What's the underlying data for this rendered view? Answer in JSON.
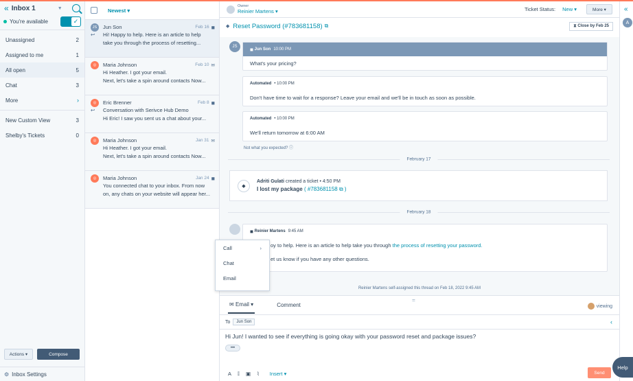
{
  "sidebar": {
    "inbox_title": "Inbox 1",
    "availability": "You're available",
    "items": [
      {
        "label": "Unassigned",
        "count": "2"
      },
      {
        "label": "Assigned to me",
        "count": "1"
      },
      {
        "label": "All open",
        "count": "5"
      },
      {
        "label": "Chat",
        "count": "3"
      },
      {
        "label": "More",
        "count": ""
      }
    ],
    "views": [
      {
        "label": "New Custom View",
        "count": "3"
      },
      {
        "label": "Shelby's Tickets",
        "count": "0"
      }
    ],
    "actions_label": "Actions ▾",
    "compose_label": "Compose",
    "settings_label": "Inbox Settings"
  },
  "thread_list": {
    "sort_label": "Newest ▾",
    "threads": [
      {
        "initials": "JS",
        "name": "Jun Son",
        "date": "Feb 16",
        "line1": "Hi! Happy to help. Here is an article to help",
        "line2": "take you through the process of resetting..."
      },
      {
        "initials": "MJ",
        "name": "Maria Johnson",
        "date": "Feb 10",
        "line1": "Hi Heather. I got your email.",
        "line2": "Next, let's take a spin around contacts Now..."
      },
      {
        "initials": "EB",
        "name": "Eric Brenner",
        "date": "Feb 8",
        "line1": "Conversation with Serivce Hub Demo",
        "line2": "Hi Eric! I saw you sent us a chat about your..."
      },
      {
        "initials": "MJ",
        "name": "Maria Johnson",
        "date": "Jan 31",
        "line1": "Hi Heather. I got your email.",
        "line2": "Next, let's take a spin around contacts Now..."
      },
      {
        "initials": "MJ",
        "name": "Maria Johnson",
        "date": "Jan 24",
        "line1": "You connected chat to your inbox. From now",
        "line2": "on, any chats on your website will appear her..."
      }
    ]
  },
  "header": {
    "owner_label": "Owner",
    "owner_name": "Reinier Martens ▾",
    "ticket_status_label": "Ticket Status:",
    "ticket_status_value": "New ▾",
    "more_label": "More ▾",
    "title": "Reset Password (#783681158)",
    "close_by": "Close by Feb 25"
  },
  "conversation": {
    "first_msg_author": "Jun Son",
    "first_msg_time": "10:00 PM",
    "first_msg_text": "What's your pricing?",
    "auto1_label": "Automated",
    "auto1_time": "• 10:00 PM",
    "auto1_text": "Don't have time to wait for a response? Leave your email and we'll be in touch as soon as possible.",
    "auto2_label": "Automated",
    "auto2_time": "• 10:00 PM",
    "auto2_text": "We'll return tomorrow at 6:00 AM",
    "note": "Not what you expected? ⓘ",
    "date1": "February 17",
    "event_author": "Adriti Gulati",
    "event_action": "created a ticket",
    "event_time": "• 4:50 PM",
    "event_subject": "I lost my package",
    "event_link": "( #783681158 ⧉ )",
    "date2": "February 18",
    "reply_author": "Reinier Martens",
    "reply_time": "9:45 AM",
    "reply_text_part1": "oy to help. Here is an article to help take you through",
    "reply_text_link": "the process of resetting your password.",
    "reply_text_part2": "et us know if you have any other questions.",
    "assign_note": "Reinier Martens self-assigned this thread on Feb 18, 2022 9:45 AM"
  },
  "dropdown": {
    "items": [
      "Call",
      "Chat",
      "Email"
    ]
  },
  "composer": {
    "tab_email": "Email ▾",
    "tab_comment": "Comment",
    "viewing": "viewing",
    "to_label": "To",
    "to_chip": "Jun Son",
    "body": "Hi Jun! I wanted to see if everything is going okay with your password reset and package issues?",
    "insert_label": "Insert ▾",
    "send_label": "Send"
  },
  "rail": {
    "avatar": "A",
    "help_label": "Help"
  },
  "colors": {
    "accent": "#0091ae",
    "brand": "#ff7a59",
    "dark": "#425b76"
  }
}
